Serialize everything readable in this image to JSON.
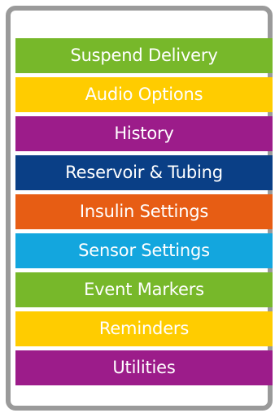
{
  "menu": {
    "items": [
      {
        "label": "Suspend Delivery",
        "bg": "#77b82a",
        "fg": "#ffffff"
      },
      {
        "label": "Audio Options",
        "bg": "#ffcc00",
        "fg": "#ffffff"
      },
      {
        "label": "History",
        "bg": "#9c1c8a",
        "fg": "#ffffff"
      },
      {
        "label": "Reservoir & Tubing",
        "bg": "#0a3f86",
        "fg": "#ffffff"
      },
      {
        "label": "Insulin Settings",
        "bg": "#e75d14",
        "fg": "#ffffff"
      },
      {
        "label": "Sensor Settings",
        "bg": "#13a6de",
        "fg": "#ffffff"
      },
      {
        "label": "Event Markers",
        "bg": "#77b82a",
        "fg": "#ffffff"
      },
      {
        "label": "Reminders",
        "bg": "#ffcc00",
        "fg": "#ffffff"
      },
      {
        "label": "Utilities",
        "bg": "#9c1c8a",
        "fg": "#ffffff"
      }
    ]
  }
}
